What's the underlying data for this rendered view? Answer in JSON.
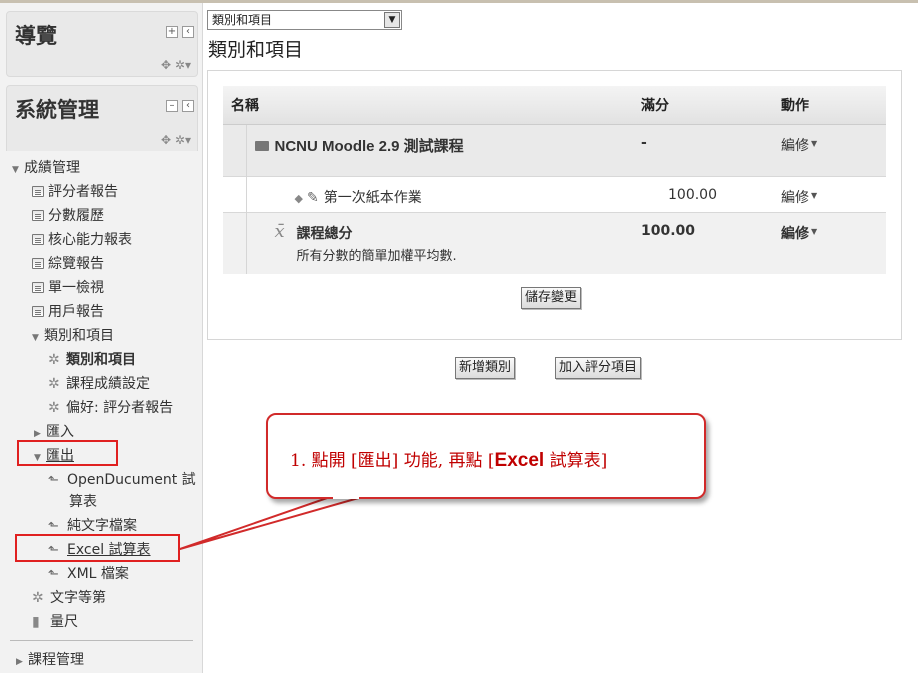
{
  "sidebar": {
    "nav_block": {
      "title": "導覽",
      "btn_add": "+",
      "btn_dock": "‹",
      "move": "✥ ✲▾"
    },
    "admin_block": {
      "title": "系統管理",
      "btn_collapse": "–",
      "btn_dock": "‹",
      "move": "✥ ✲▾"
    },
    "tree": {
      "grades": "成績管理",
      "grader_report": "評分者報告",
      "grade_history": "分數履歷",
      "outcomes_report": "核心能力報表",
      "overview_report": "綜覽報告",
      "single_view": "單一檢視",
      "user_report": "用戶報告",
      "categories_items": "類別和項目",
      "categories_items_sub": "類別和項目",
      "course_grade_settings": "課程成績設定",
      "preferences_grader": "偏好: 評分者報告",
      "import": "匯入",
      "export": "匯出",
      "export_ods_1": "OpenDucument 試",
      "export_ods_2": "算表",
      "export_txt": "純文字檔案",
      "export_excel": "Excel 試算表",
      "export_xml": "XML 檔案",
      "letters": "文字等第",
      "scales": "量尺",
      "course_admin": "課程管理"
    }
  },
  "main": {
    "select_value": "類別和項目",
    "page_title": "類別和項目",
    "table": {
      "headers": {
        "name": "名稱",
        "max": "滿分",
        "actions": "動作"
      },
      "category": {
        "name": "NCNU Moodle 2.9 測試課程",
        "max": "-",
        "action": "編修"
      },
      "item": {
        "name": "第一次紙本作業",
        "max": "100.00",
        "action": "編修"
      },
      "total": {
        "name": "課程總分",
        "desc": "所有分數的簡單加權平均數.",
        "max": "100.00",
        "action": "編修"
      }
    },
    "save_button": "儲存變更",
    "add_category_button": "新增類別",
    "add_item_button": "加入評分項目"
  },
  "callout": {
    "prefix": "1. 點開 [匯出] 功能, 再點 [",
    "strong": "Excel",
    "suffix": " 試算表]"
  },
  "colors": {
    "annotation_red": "#e02020"
  }
}
